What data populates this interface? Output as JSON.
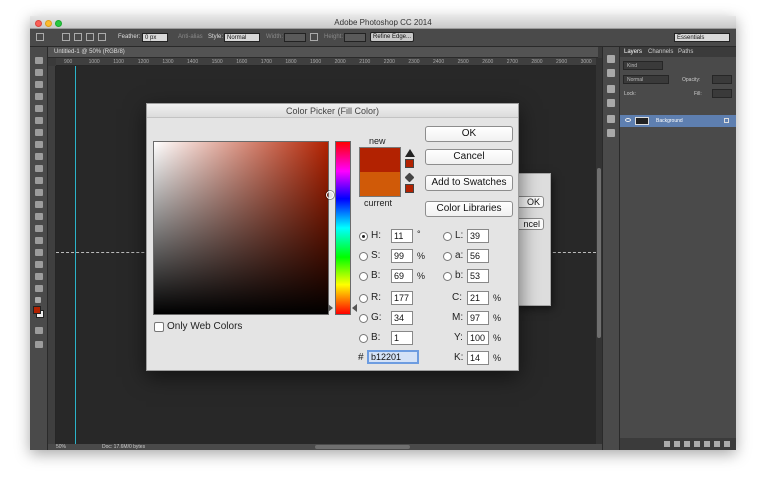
{
  "app": {
    "title": "Adobe Photoshop CC 2014",
    "window_controls": [
      "close",
      "minimize",
      "zoom"
    ]
  },
  "options_bar": {
    "feather_label": "Feather:",
    "feather_value": "0 px",
    "antialias_label": "Anti-alias",
    "style_label": "Style:",
    "style_value": "Normal",
    "width_label": "Width:",
    "height_label": "Height:",
    "refine_edge_label": "Refine Edge...",
    "workspace_value": "Essentials"
  },
  "document": {
    "tab_label": "Untitled-1 @ 50% (RGB/8)",
    "ruler_ticks": [
      "900",
      "1000",
      "1100",
      "1200",
      "1300",
      "1400",
      "1500",
      "1600",
      "1700",
      "1800",
      "1900",
      "2000",
      "2100",
      "2200",
      "2300",
      "2400",
      "2500",
      "2600",
      "2700",
      "2800",
      "2900",
      "3000"
    ],
    "zoom": "50%",
    "doc_info": "Doc: 17.6M/0 bytes"
  },
  "layers_panel": {
    "tabs": [
      "Layers",
      "Channels",
      "Paths"
    ],
    "kind_label": "Kind",
    "blend_mode": "Normal",
    "opacity_label": "Opacity:",
    "lock_label": "Lock:",
    "fill_label": "Fill:",
    "layer_name": "Background"
  },
  "background_dialog": {
    "ok_partial": "OK",
    "cancel_partial": "ncel"
  },
  "color_picker": {
    "title": "Color Picker (Fill Color)",
    "new_label": "new",
    "current_label": "current",
    "buttons": {
      "ok": "OK",
      "cancel": "Cancel",
      "add_to_swatches": "Add to Swatches",
      "color_libraries": "Color Libraries"
    },
    "hsb": {
      "h": {
        "label": "H:",
        "value": "11",
        "unit": "°"
      },
      "s": {
        "label": "S:",
        "value": "99",
        "unit": "%"
      },
      "b": {
        "label": "B:",
        "value": "69",
        "unit": "%"
      }
    },
    "lab": {
      "l": {
        "label": "L:",
        "value": "39"
      },
      "a": {
        "label": "a:",
        "value": "56"
      },
      "b": {
        "label": "b:",
        "value": "53"
      }
    },
    "rgb": {
      "r": {
        "label": "R:",
        "value": "177"
      },
      "g": {
        "label": "G:",
        "value": "34"
      },
      "b": {
        "label": "B:",
        "value": "1"
      }
    },
    "cmyk": {
      "c": {
        "label": "C:",
        "value": "21",
        "unit": "%"
      },
      "m": {
        "label": "M:",
        "value": "97",
        "unit": "%"
      },
      "y": {
        "label": "Y:",
        "value": "100",
        "unit": "%"
      },
      "k": {
        "label": "K:",
        "value": "14",
        "unit": "%"
      }
    },
    "hex_label": "#",
    "hex_value": "b12201",
    "only_web_colors_label": "Only Web Colors",
    "only_web_colors_checked": false,
    "selected_mode": "H",
    "colors": {
      "new": "#b22201",
      "current": "#d05a08"
    }
  }
}
